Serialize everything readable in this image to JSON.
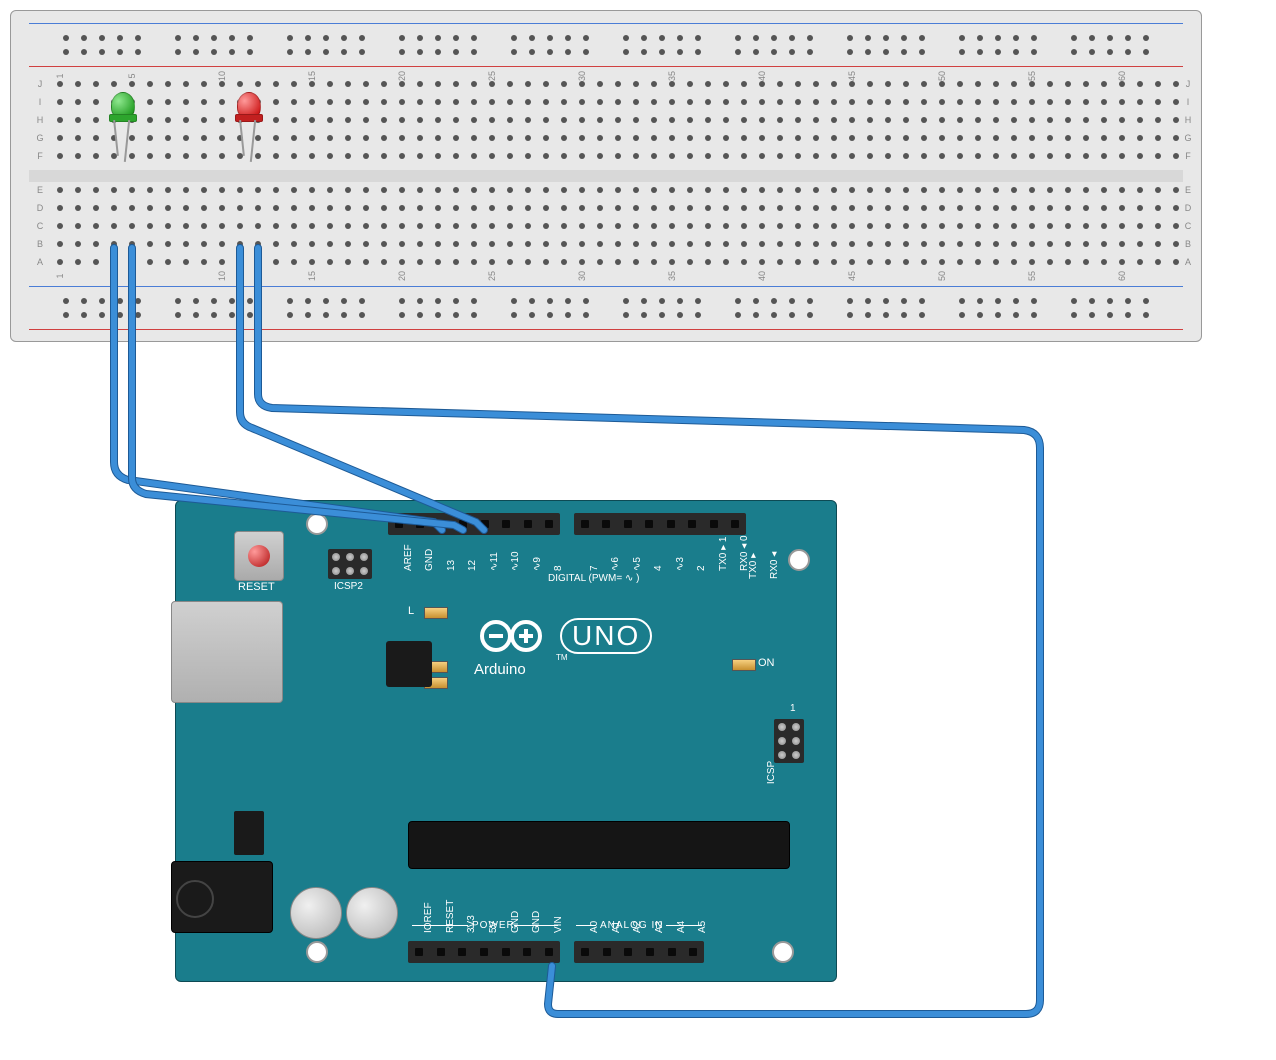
{
  "breadboard": {
    "row_labels_left": [
      "A",
      "B",
      "C",
      "D",
      "E",
      "F",
      "G",
      "H",
      "I",
      "J"
    ],
    "col_numbers": [
      1,
      5,
      10,
      15,
      20,
      25,
      30,
      35,
      40,
      45,
      50,
      55,
      60
    ]
  },
  "leds": [
    {
      "name": "green-led",
      "color": "green",
      "col": 5
    },
    {
      "name": "red-led",
      "color": "red",
      "col": 12
    }
  ],
  "arduino": {
    "name": "Arduino",
    "model": "UNO",
    "reset_label": "RESET",
    "icsp2_label": "ICSP2",
    "icsp_label": "ICSP",
    "on_label": "ON",
    "tx_label": "TX",
    "rx_label": "RX",
    "l_label": "L",
    "tm_label": "TM",
    "one_label": "1",
    "digital_label": "DIGITAL (PWM= ∿ )",
    "power_label": "POWER",
    "analog_label": "ANALOG IN",
    "top_header1": [
      "AREF",
      "GND",
      "13",
      "12",
      "∿11",
      "∿10",
      "∿9",
      "8"
    ],
    "top_header2": [
      "7",
      "∿6",
      "∿5",
      "4",
      "∿3",
      "2",
      "TX0 ▸ 1",
      "RX0 ◂ 0"
    ],
    "bottom_header1": [
      "IOREF",
      "RESET",
      "3V3",
      "5V",
      "GND",
      "GND",
      "VIN"
    ],
    "bottom_header2": [
      "A0",
      "A1",
      "A2",
      "A3",
      "A4",
      "A5"
    ]
  },
  "wires": [
    {
      "name": "wire-green-anode-to-d12",
      "from": "breadboard col5 lead1",
      "to": "arduino D12"
    },
    {
      "name": "wire-green-cathode-to-d11",
      "from": "breadboard col6 lead2",
      "to": "arduino D11"
    },
    {
      "name": "wire-red-anode-to-d10",
      "from": "breadboard col12 lead1",
      "to": "arduino D10"
    },
    {
      "name": "wire-red-cathode-to-vin",
      "from": "breadboard col13 lead2",
      "to": "arduino VIN"
    }
  ]
}
